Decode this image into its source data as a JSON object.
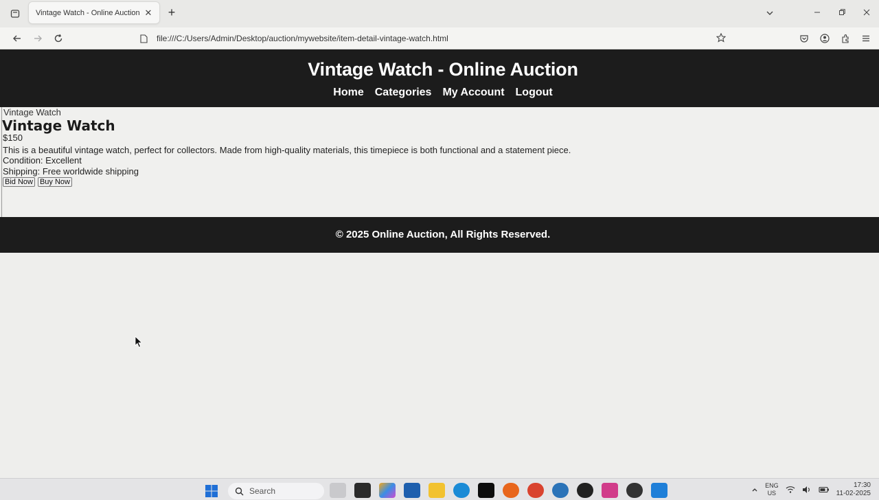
{
  "browser": {
    "tab_title": "Vintage Watch - Online Auction",
    "url": "file:///C:/Users/Admin/Desktop/auction/mywebsite/item-detail-vintage-watch.html",
    "new_tab_symbol": "+",
    "tab_close_symbol": "✕",
    "icons": [
      "tab-list-icon",
      "close-icon",
      "plus-icon",
      "chevron-down-icon",
      "minimize-icon",
      "restore-icon",
      "window-close-icon",
      "back-arrow-icon",
      "forward-arrow-icon",
      "reload-icon",
      "page-icon",
      "star-icon",
      "pocket-icon",
      "account-icon",
      "extensions-icon",
      "menu-icon"
    ]
  },
  "site": {
    "title": "Vintage Watch - Online Auction",
    "nav": [
      "Home",
      "Categories",
      "My Account",
      "Logout"
    ],
    "footer": "© 2025 Online Auction, All Rights Reserved."
  },
  "item": {
    "breadcrumb": "Vintage Watch",
    "name": "Vintage Watch",
    "price": "$150",
    "description": "This is a beautiful vintage watch, perfect for collectors. Made from high-quality materials, this timepiece is both functional and a statement piece.",
    "condition": "Condition: Excellent",
    "shipping": "Shipping: Free worldwide shipping",
    "bid_label": "Bid Now",
    "buy_label": "Buy Now"
  },
  "taskbar": {
    "search_label": "Search",
    "lang_line1": "ENG",
    "lang_line2": "US",
    "time": "17:30",
    "date": "11-02-2025"
  },
  "colors": {
    "header_bg": "#1c1c1c",
    "page_bg": "#eeeeec",
    "header_text": "#ffffff"
  }
}
